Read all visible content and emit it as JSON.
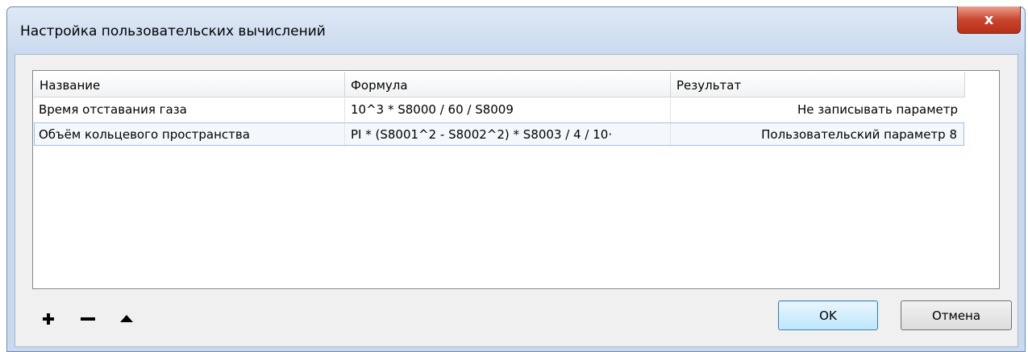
{
  "window": {
    "title": "Настройка пользовательских вычислений",
    "close_label": "x"
  },
  "table": {
    "columns": [
      "Название",
      "Формула",
      "Результат"
    ],
    "rows": [
      {
        "name": "Время отставания газа",
        "formula": "10^3 * S8000 / 60 / S8009",
        "result": "Не записывать параметр",
        "selected": false
      },
      {
        "name": "Объём кольцевого пространства",
        "formula": "PI * (S8001^2 - S8002^2) * S8003 / 4 / 10·",
        "result": "Пользовательский параметр 8",
        "selected": true
      }
    ]
  },
  "toolbar": {
    "icons": [
      "plus-icon",
      "minus-icon",
      "move-up-icon"
    ]
  },
  "buttons": {
    "ok_label": "OK",
    "cancel_label": "Отмена"
  }
}
